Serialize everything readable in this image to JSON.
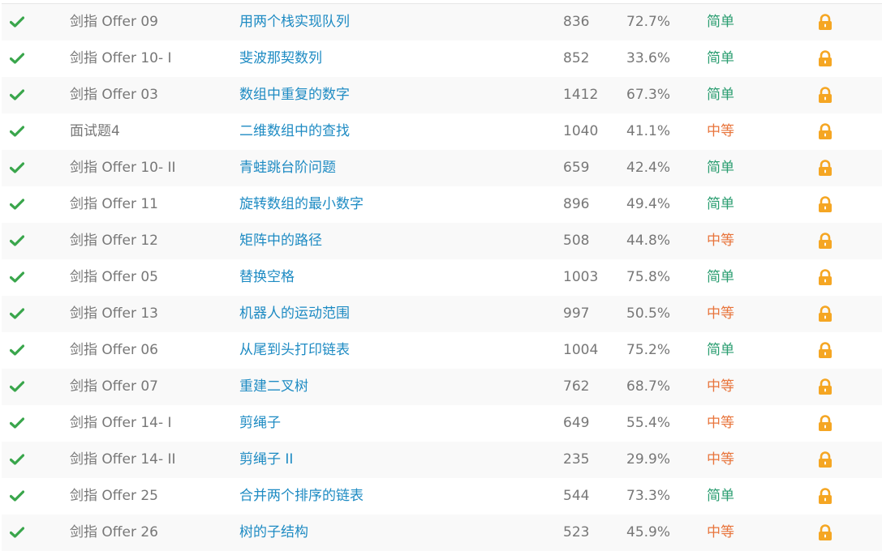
{
  "colors": {
    "check": "#3aa64c",
    "title_link": "#1e8bc3",
    "muted_text": "#777777",
    "easy": "#2a9d70",
    "medium": "#e8743b",
    "lock": "#f5a623"
  },
  "icons": {
    "status": "check-icon",
    "premium": "lock-icon"
  },
  "rows": [
    {
      "id": "剑指 Offer 09",
      "title": "用两个栈实现队列",
      "solutions": "836",
      "acceptance": "72.7%",
      "difficulty": "简单",
      "level": "easy"
    },
    {
      "id": "剑指 Offer 10- I",
      "title": "斐波那契数列",
      "solutions": "852",
      "acceptance": "33.6%",
      "difficulty": "简单",
      "level": "easy"
    },
    {
      "id": "剑指 Offer 03",
      "title": "数组中重复的数字",
      "solutions": "1412",
      "acceptance": "67.3%",
      "difficulty": "简单",
      "level": "easy"
    },
    {
      "id": "面试题4",
      "title": "二维数组中的查找",
      "solutions": "1040",
      "acceptance": "41.1%",
      "difficulty": "中等",
      "level": "medium"
    },
    {
      "id": "剑指 Offer 10- II",
      "title": "青蛙跳台阶问题",
      "solutions": "659",
      "acceptance": "42.4%",
      "difficulty": "简单",
      "level": "easy"
    },
    {
      "id": "剑指 Offer 11",
      "title": "旋转数组的最小数字",
      "solutions": "896",
      "acceptance": "49.4%",
      "difficulty": "简单",
      "level": "easy"
    },
    {
      "id": "剑指 Offer 12",
      "title": "矩阵中的路径",
      "solutions": "508",
      "acceptance": "44.8%",
      "difficulty": "中等",
      "level": "medium"
    },
    {
      "id": "剑指 Offer 05",
      "title": "替换空格",
      "solutions": "1003",
      "acceptance": "75.8%",
      "difficulty": "简单",
      "level": "easy"
    },
    {
      "id": "剑指 Offer 13",
      "title": "机器人的运动范围",
      "solutions": "997",
      "acceptance": "50.5%",
      "difficulty": "中等",
      "level": "medium"
    },
    {
      "id": "剑指 Offer 06",
      "title": "从尾到头打印链表",
      "solutions": "1004",
      "acceptance": "75.2%",
      "difficulty": "简单",
      "level": "easy"
    },
    {
      "id": "剑指 Offer 07",
      "title": "重建二叉树",
      "solutions": "762",
      "acceptance": "68.7%",
      "difficulty": "中等",
      "level": "medium"
    },
    {
      "id": "剑指 Offer 14- I",
      "title": "剪绳子",
      "solutions": "649",
      "acceptance": "55.4%",
      "difficulty": "中等",
      "level": "medium"
    },
    {
      "id": "剑指 Offer 14- II",
      "title": "剪绳子 II",
      "solutions": "235",
      "acceptance": "29.9%",
      "difficulty": "中等",
      "level": "medium"
    },
    {
      "id": "剑指 Offer 25",
      "title": "合并两个排序的链表",
      "solutions": "544",
      "acceptance": "73.3%",
      "difficulty": "简单",
      "level": "easy"
    },
    {
      "id": "剑指 Offer 26",
      "title": "树的子结构",
      "solutions": "523",
      "acceptance": "45.9%",
      "difficulty": "中等",
      "level": "medium"
    }
  ]
}
